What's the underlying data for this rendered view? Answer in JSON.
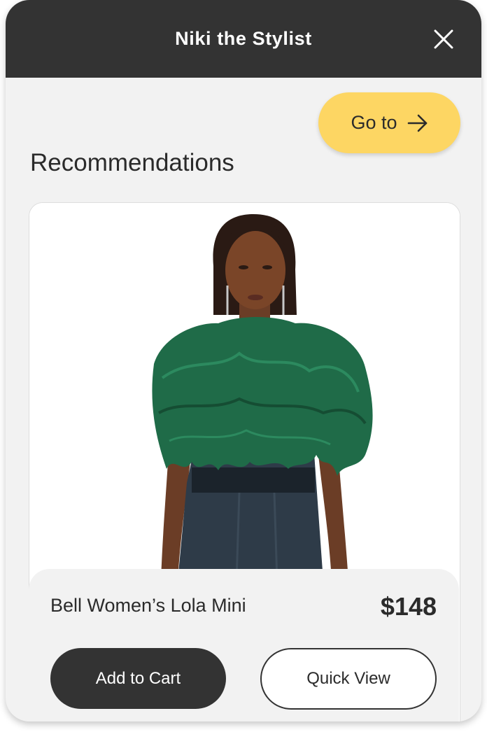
{
  "header": {
    "title": "Niki the Stylist",
    "close_icon": "close-icon"
  },
  "goto": {
    "label": "Go to",
    "icon": "arrow-right-icon",
    "color": "#fdd663"
  },
  "section": {
    "title": "Recommendations"
  },
  "product": {
    "image_alt": "Model wearing green feather cape over navy satin mini dress",
    "name": "Bell Women’s Lola Mini",
    "price": "$148",
    "add_to_cart_label": "Add to Cart",
    "quick_view_label": "Quick View"
  },
  "colors": {
    "header_bg": "#333333",
    "panel_bg": "#f2f2f2",
    "accent": "#fdd663",
    "feather": "#1f6b48",
    "dress": "#2e3b48"
  }
}
